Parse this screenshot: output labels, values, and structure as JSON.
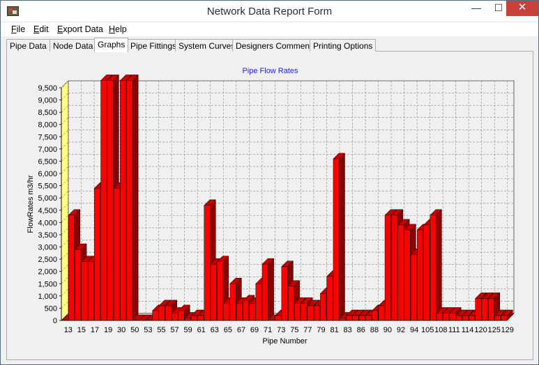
{
  "window": {
    "title": "Network Data Report Form",
    "controls": {
      "minimize": "—",
      "maximize": "☐",
      "close": "✕"
    }
  },
  "menu": [
    {
      "label": "File",
      "underline": "F",
      "rest": "ile"
    },
    {
      "label": "Edit",
      "underline": "E",
      "rest": "dit"
    },
    {
      "label": "Export Data",
      "underline": "E",
      "rest": "xport Data"
    },
    {
      "label": "Help",
      "underline": "H",
      "rest": "elp"
    }
  ],
  "tabs": [
    {
      "label": "Pipe Data",
      "active": false
    },
    {
      "label": "Node Data",
      "active": false
    },
    {
      "label": "Graphs",
      "active": true
    },
    {
      "label": "Pipe Fittings",
      "active": false
    },
    {
      "label": "System Curves",
      "active": false
    },
    {
      "label": "Designers Comments",
      "active": false
    },
    {
      "label": "Printing Options",
      "active": false
    }
  ],
  "colors": {
    "bar_front": "#ff0000",
    "bar_side": "#8b0000",
    "bar_top": "#cc0000",
    "wall_left": "#ffff80",
    "title_color": "#1a1aff"
  },
  "chart_data": {
    "type": "bar",
    "title": "Pipe Flow Rates",
    "xlabel": "Pipe Number",
    "ylabel": "FlowRates m3/hr",
    "ylim": [
      0,
      9500
    ],
    "yticks": [
      0,
      500,
      1000,
      1500,
      2000,
      2500,
      3000,
      3500,
      4000,
      4500,
      5000,
      5500,
      6000,
      6500,
      7000,
      7500,
      8000,
      8500,
      9000,
      9500
    ],
    "ytick_labels": [
      "0",
      "500",
      "1,000",
      "1,500",
      "2,000",
      "2,500",
      "3,000",
      "3,500",
      "4,000",
      "4,500",
      "5,000",
      "5,500",
      "6,000",
      "6,500",
      "7,000",
      "7,500",
      "8,000",
      "8,500",
      "9,000",
      "9,500"
    ],
    "grid": true,
    "xtick_labels": [
      "13",
      "15",
      "17",
      "19",
      "30",
      "50",
      "53",
      "55",
      "57",
      "59",
      "61",
      "63",
      "65",
      "67",
      "69",
      "71",
      "73",
      "75",
      "77",
      "79",
      "81",
      "83",
      "86",
      "88",
      "90",
      "92",
      "94",
      "105",
      "108",
      "111",
      "114",
      "120",
      "125",
      "129"
    ],
    "values": [
      0,
      4300,
      2900,
      2400,
      2400,
      5400,
      9800,
      9800,
      5400,
      9800,
      9800,
      0,
      0,
      0,
      400,
      600,
      600,
      300,
      400,
      100,
      200,
      200,
      4700,
      2300,
      2400,
      700,
      1500,
      700,
      800,
      700,
      1500,
      2300,
      0,
      200,
      2200,
      1400,
      700,
      700,
      600,
      600,
      1100,
      1800,
      6600,
      100,
      200,
      200,
      200,
      200,
      400,
      600,
      4300,
      4300,
      3900,
      3700,
      2700,
      3700,
      3900,
      4300,
      300,
      300,
      300,
      200,
      200,
      200,
      900,
      900,
      900,
      200,
      200
    ]
  }
}
